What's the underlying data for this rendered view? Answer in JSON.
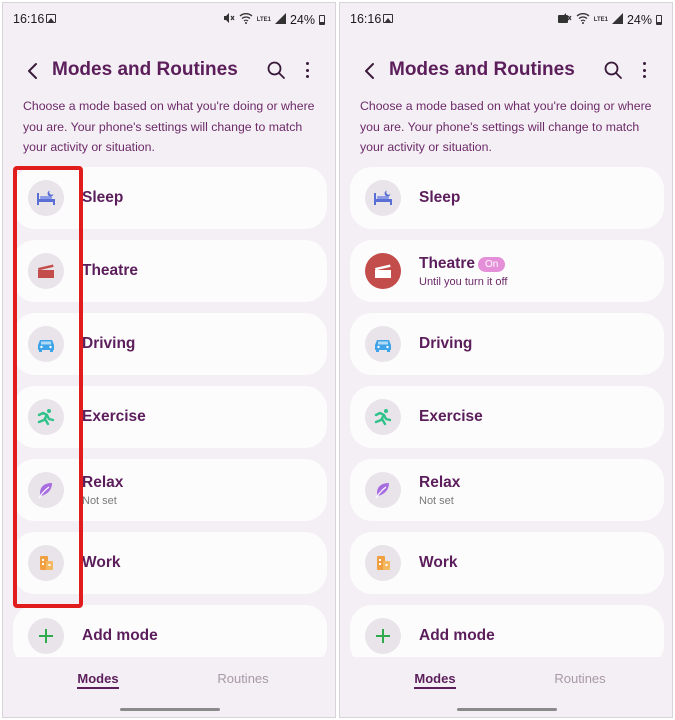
{
  "screens": [
    {
      "status": {
        "time": "16:16",
        "battery": "24%",
        "network": "LTE1"
      },
      "header": {
        "title": "Modes and Routines"
      },
      "description": "Choose a mode based on what you're doing or where you are. Your phone's settings will change to match your activity or situation.",
      "modes": [
        {
          "label": "Sleep"
        },
        {
          "label": "Theatre"
        },
        {
          "label": "Driving"
        },
        {
          "label": "Exercise"
        },
        {
          "label": "Relax",
          "sub": "Not set"
        },
        {
          "label": "Work"
        }
      ],
      "add_mode": "Add mode",
      "nav": {
        "modes": "Modes",
        "routines": "Routines"
      }
    },
    {
      "status": {
        "time": "16:16",
        "battery": "24%",
        "network": "LTE1"
      },
      "header": {
        "title": "Modes and Routines"
      },
      "description": "Choose a mode based on what you're doing or where you are. Your phone's settings will change to match your activity or situation.",
      "modes": [
        {
          "label": "Sleep"
        },
        {
          "label": "Theatre",
          "badge": "On",
          "sub": "Until you turn it off"
        },
        {
          "label": "Driving"
        },
        {
          "label": "Exercise"
        },
        {
          "label": "Relax",
          "sub": "Not set"
        },
        {
          "label": "Work"
        }
      ],
      "add_mode": "Add mode",
      "nav": {
        "modes": "Modes",
        "routines": "Routines"
      }
    }
  ],
  "icons": {
    "sleep": "bed-icon",
    "theatre": "clapperboard-icon",
    "driving": "car-icon",
    "exercise": "running-icon",
    "relax": "leaf-icon",
    "work": "building-icon",
    "add": "plus-icon"
  },
  "colors": {
    "title": "#5b1e5b",
    "panel_bg": "#f4eff4",
    "card_bg": "#fdfcfd",
    "theatre_active": "#c24d4a",
    "on_badge": "#e58fd8",
    "highlight": "#e11c1c",
    "sleep_icon": "#5a6fd6",
    "theatre_icon": "#c24d4a",
    "driving_icon": "#3ea3e8",
    "exercise_icon": "#2fc28a",
    "relax_icon": "#a86de0",
    "work_icon": "#f0a040",
    "add_icon": "#2faa4c"
  }
}
